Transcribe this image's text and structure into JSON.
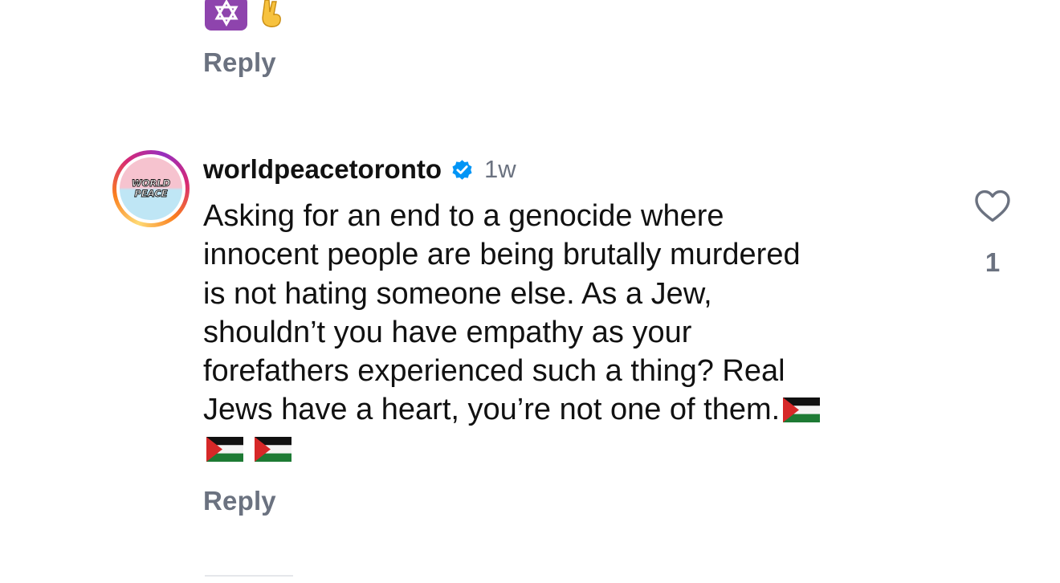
{
  "previous_comment": {
    "emoji_icons": [
      "star-of-david-icon",
      "victory-hand-icon"
    ],
    "reply_label": "Reply"
  },
  "comment": {
    "avatar_text": "WORLD PEACE",
    "username": "worldpeacetoronto",
    "verified": true,
    "timestamp": "1w",
    "text_lines": [
      "Asking for an end to a genocide where",
      "innocent people are being brutally murdered",
      "is not hating someone else. As a Jew,",
      "shouldn’t you have empathy as your",
      "forefathers experienced such a thing? Real",
      "Jews have a heart, you’re not one of them."
    ],
    "trailing_icons": [
      "palestine-flag-icon",
      "palestine-flag-icon",
      "palestine-flag-icon"
    ],
    "reply_label": "Reply",
    "like_count": "1"
  },
  "colors": {
    "verified_blue": "#0095f6",
    "muted_gray": "#6b7280",
    "text": "#111111",
    "purple_emoji_bg": "#8e44ad"
  }
}
